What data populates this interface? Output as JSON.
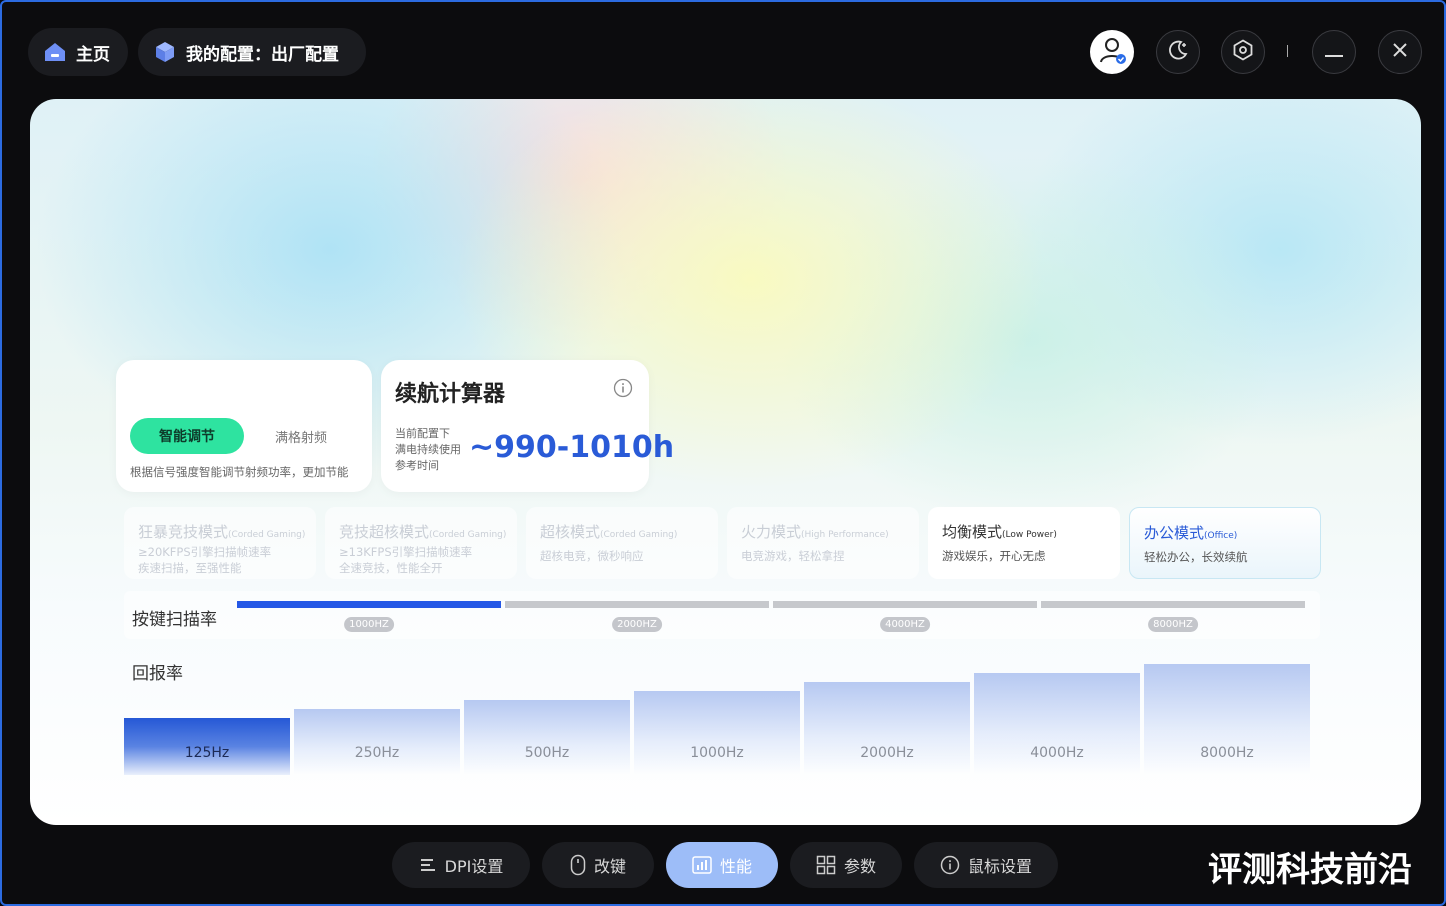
{
  "topbar": {
    "home_label": "主页",
    "config_label": "我的配置：出厂配置"
  },
  "frequency": {
    "smart_label": "智能调节",
    "full_label": "满格射频",
    "description": "根据信号强度智能调节射频功率，更加节能"
  },
  "calculator": {
    "title": "续航计算器",
    "line1": "当前配置下",
    "line2": "满电持续使用",
    "line3": "参考时间",
    "value": "~990-1010h"
  },
  "modes": [
    {
      "title": "狂暴竞技模式",
      "en": "(Corded Gaming)",
      "sub": "≥20KFPS引擎扫描帧速率",
      "desc": "疾速扫描，至强性能",
      "state": "disabled"
    },
    {
      "title": "竞技超核模式",
      "en": "(Corded Gaming)",
      "sub": "≥13KFPS引擎扫描帧速率",
      "desc": "全速竞技，性能全开",
      "state": "disabled"
    },
    {
      "title": "超核模式",
      "en": "(Corded Gaming)",
      "sub": "",
      "desc": "超核电竞，微秒响应",
      "state": "disabled"
    },
    {
      "title": "火力模式",
      "en": "(High Performance)",
      "sub": "",
      "desc": "电竞游戏，轻松拿捏",
      "state": "disabled"
    },
    {
      "title": "均衡模式",
      "en": "(Low Power)",
      "sub": "",
      "desc": "游戏娱乐，开心无虑",
      "state": "active"
    },
    {
      "title": "办公模式",
      "en": "(Office)",
      "sub": "",
      "desc": "轻松办公，长效续航",
      "state": "selected"
    }
  ],
  "scan_rate": {
    "label": "按键扫描率",
    "options": [
      "1000HZ",
      "2000HZ",
      "4000HZ",
      "8000HZ"
    ],
    "selected_index": 0,
    "active_color": "#2558e6",
    "inactive_color": "#c6c8cc"
  },
  "report_rate": {
    "label": "回报率",
    "options": [
      "125Hz",
      "250Hz",
      "500Hz",
      "1000Hz",
      "2000Hz",
      "4000Hz",
      "8000Hz"
    ],
    "selected_index": 0
  },
  "tabs": [
    {
      "label": "DPI设置",
      "icon": "dpi-icon"
    },
    {
      "label": "改键",
      "icon": "mouse-icon"
    },
    {
      "label": "性能",
      "icon": "performance-icon",
      "active": true
    },
    {
      "label": "参数",
      "icon": "grid-icon"
    },
    {
      "label": "鼠标设置",
      "icon": "info-icon"
    }
  ],
  "watermark": "评测科技前沿",
  "colors": {
    "accent": "#2a5bd7",
    "smart_green": "#2ee3a0",
    "active_tab": "#9dbdf8"
  }
}
